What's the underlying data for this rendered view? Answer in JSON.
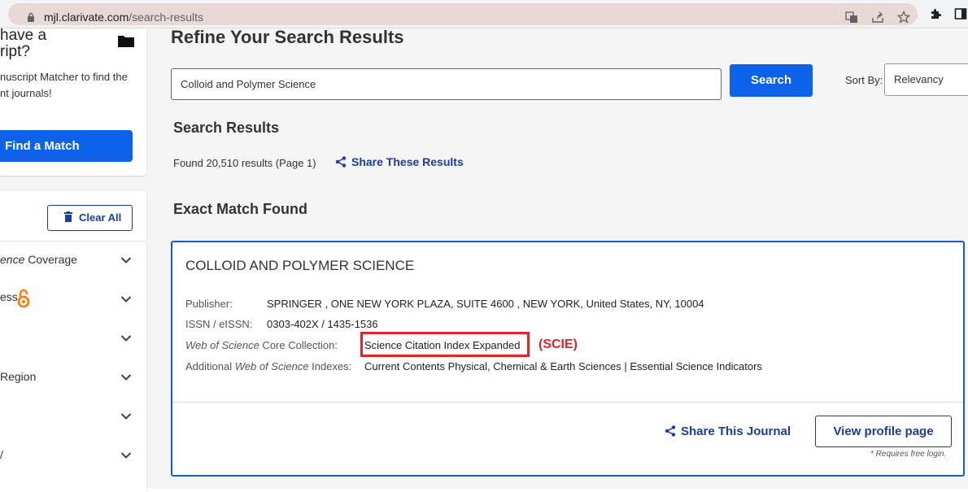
{
  "browser": {
    "url_domain": "mjl.clarivate.com",
    "url_path": "/search-results"
  },
  "sidebar": {
    "promo": {
      "title_line1": "have a",
      "title_line2": "ript?",
      "desc_line1": "nuscript Matcher to find the",
      "desc_line2": "nt journals!",
      "button": "Find a Match"
    },
    "clear_all": "Clear All",
    "filters": [
      {
        "pre": "ence",
        "post": " Coverage"
      },
      {
        "pre": "ess",
        "post": ""
      },
      {
        "pre": "",
        "post": ""
      },
      {
        "pre": "Region",
        "post": ""
      },
      {
        "pre": "",
        "post": ""
      },
      {
        "pre": "/",
        "post": ""
      }
    ]
  },
  "main": {
    "refine_title": "Refine Your Search Results",
    "search_value": "Colloid and Polymer Science",
    "search_button": "Search",
    "sort_label": "Sort By:",
    "sort_value": "Relevancy",
    "results_title": "Search Results",
    "found_text": "Found 20,510 results (Page 1)",
    "share_results": "Share These Results",
    "exact_title": "Exact Match Found"
  },
  "journal": {
    "name": "COLLOID AND POLYMER SCIENCE",
    "publisher_label": "Publisher:",
    "publisher": "SPRINGER , ONE NEW YORK PLAZA, SUITE 4600 , NEW YORK, United States, NY, 10004",
    "issn_label": "ISSN / eISSN:",
    "issn": "0303-402X / 1435-1536",
    "wos_label_italic": "Web of Science",
    "wos_label_rest": " Core Collection:",
    "wos_value": "Science Citation Index Expanded",
    "scie_annotation": "(SCIE)",
    "add_label_pre": "Additional ",
    "add_label_italic": "Web of Science",
    "add_label_post": " Indexes:",
    "add_value": "Current Contents Physical, Chemical & Earth Sciences | Essential Science Indicators",
    "share_journal": "Share This Journal",
    "view_profile": "View profile page",
    "requires_login": "* Requires free login."
  },
  "colors": {
    "primary_blue": "#0d62ea",
    "link_navy": "#1a3c9e",
    "highlight_red": "#e0242a",
    "oa_orange": "#f68212"
  }
}
